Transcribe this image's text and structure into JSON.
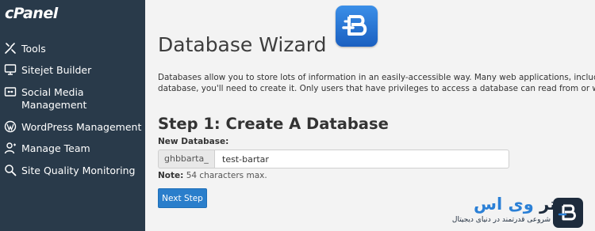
{
  "sidebar": {
    "logo": "cPanel",
    "items": [
      {
        "label": "Tools",
        "icon": "tools-icon"
      },
      {
        "label": "Sitejet Builder",
        "icon": "monitor-icon"
      },
      {
        "label": "Social Media",
        "label2": "Management",
        "icon": "social-icon"
      },
      {
        "label": "WordPress Management",
        "icon": "wordpress-icon"
      },
      {
        "label": "Manage Team",
        "icon": "user-icon"
      },
      {
        "label": "Site Quality Monitoring",
        "icon": "search-icon"
      }
    ]
  },
  "main": {
    "title": "Database Wizard",
    "description_line1": "Databases allow you to store lots of information in an easily-accessible way. Many web applications, including some bulletin",
    "description_line2": "database, you'll need to create it. Only users that have privileges to access a database can read from or write to that databa",
    "step_title": "Step 1: Create A Database",
    "field_label": "New Database:",
    "db_prefix": "ghbbarta_",
    "db_name_value": "test-bartar",
    "note_label": "Note:",
    "note_text": "54 characters max.",
    "next_button": "Next Step"
  },
  "brand": {
    "name_part1": "برتر",
    "name_part2": "وی اس",
    "tagline": "شروعی قدرتمند در دنیای دیجیتال"
  },
  "colors": {
    "sidebar_bg": "#293a4a",
    "button_bg": "#2a7ecb",
    "brand_dark": "#1d2b3c",
    "brand_accent": "#2b80d6"
  }
}
